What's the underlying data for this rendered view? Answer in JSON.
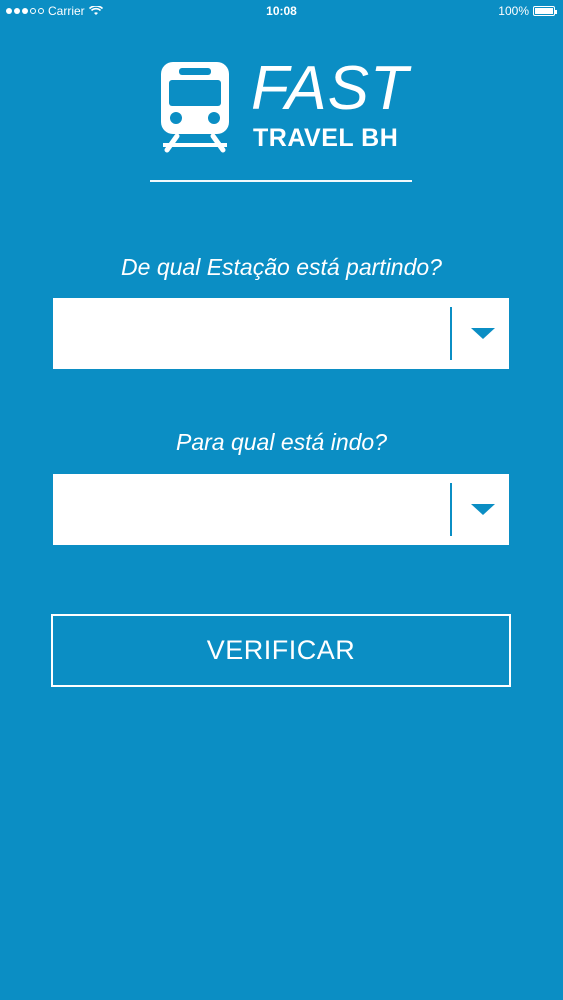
{
  "status_bar": {
    "carrier": "Carrier",
    "time": "10:08",
    "battery": "100%",
    "signal_bars_filled": 3,
    "signal_bars_total": 5
  },
  "logo": {
    "title": "FAST",
    "subtitle": "TRAVEL BH",
    "icon": "train-icon"
  },
  "form": {
    "departure_label": "De qual Estação está partindo?",
    "departure_value": "",
    "destination_label": "Para qual está indo?",
    "destination_value": "",
    "verify_button": "VERIFICAR"
  },
  "colors": {
    "background": "#0B8EC4",
    "foreground": "#FFFFFF"
  }
}
